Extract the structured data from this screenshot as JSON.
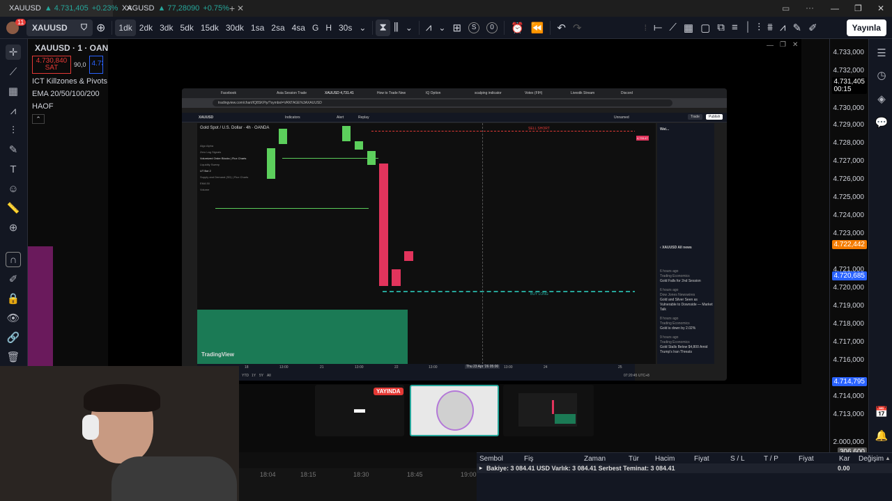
{
  "tabs": [
    {
      "symbol": "XAUUSD",
      "price": "4.731,405",
      "change": "+0.23%"
    },
    {
      "symbol": "XAGUSD",
      "price": "77,28090",
      "change": "+0.75%"
    }
  ],
  "new_tab": "+",
  "window_controls": {
    "minimize": "—",
    "maximize": "❐",
    "close": "✕"
  },
  "toolbar": {
    "notif_count": "11",
    "symbol": "XAUUSD",
    "intervals": [
      "1dk",
      "2dk",
      "3dk",
      "5dk",
      "15dk",
      "30dk",
      "1sa",
      "2sa",
      "4sa",
      "G",
      "H",
      "30s"
    ],
    "selected_interval": "1dk",
    "counter_s": "S",
    "counter_0": "0",
    "publish": "Yayınla"
  },
  "legend": {
    "title": "XAUUSD · 1 · OAND",
    "sell": "4.730,840",
    "sell_label": "SAT",
    "spread": "90,0",
    "buy": "4.73",
    "ind1": "ICT Killzones & Pivots [TF",
    "ind2": "EMA 20/50/100/200",
    "ind3": "HAOF"
  },
  "axis": {
    "labels": [
      "4.733,000",
      "4.732,000",
      "4.730,000",
      "4.729,000",
      "4.728,000",
      "4.727,000",
      "4.726,000",
      "4.725,000",
      "4.724,000",
      "4.723,000",
      "4.721,000",
      "4.720,000",
      "4.719,000",
      "4.718,000",
      "4.717,000",
      "4.716,000",
      "4.714,000",
      "4.713,000",
      "2.000,000"
    ],
    "current": "4.731,405",
    "timer": "00:15",
    "tag1": "4.722,442",
    "tag1_color": "#f57c00",
    "tag2": "4.720,685",
    "tag2_color": "#2962ff",
    "tag3": "4.714,795",
    "tag3_color": "#2962ff",
    "tag4": "306.600"
  },
  "inner": {
    "tabs": [
      "Facebook",
      "Asia Session Trade",
      "XAUUSD 4,731.41",
      "How to Trade New",
      "IQ Option",
      "scalping indicator",
      "Votex (FIH)",
      "Livestik Stream",
      "Discord"
    ],
    "url": "tradingview.com/chart/IQ8SKPiy/?symbol=VANTAGE%3AXAUUSD",
    "symbol": "XAUUSD",
    "chart_title": "Gold Spot / U.S. Dollar · 4h · OANDA",
    "sell_short": "SELL SHORT",
    "buy_long": "BUY LONG",
    "indicators": "Indicators",
    "alert": "Alert",
    "replay": "Replay",
    "trade": "Trade",
    "publish": "Publish",
    "unnamed": "Unnamed",
    "ind_lines": [
      "Algo Alpha",
      "Zero Lag Signals",
      "Volumized Order Blocks | Flux Charts",
      "Liquidity Sweep",
      "UT Bot 2",
      "Supply and Demand (SD) | Flux Charts",
      "EMA 50",
      "Volume"
    ],
    "time_labels": [
      "18",
      "13:00",
      "21",
      "13:00",
      "22",
      "13:00",
      "Thu 23 Apr '26 05:00",
      "13:00",
      "24",
      "25"
    ],
    "periods": [
      "1D",
      "5D",
      "1M",
      "3M",
      "6M",
      "YTD",
      "1Y",
      "5Y",
      "All"
    ],
    "clock": "07:20:45 UTC+8",
    "watchlist_title": "Wat...",
    "news_title": "XAUUSD All news",
    "news": [
      {
        "time": "6 hours ago",
        "src": "Trading Economics",
        "title": "Gold Falls for 2nd Session"
      },
      {
        "time": "6 hours ago",
        "src": "Dow Jones Newswires",
        "title": "Gold and Silver Seen as Vulnerable to Downside — Market Talk"
      },
      {
        "time": "8 hours ago",
        "src": "Trading Economics",
        "title": "Gold is down by 2.02%"
      },
      {
        "time": "9 hours ago",
        "src": "Trading Economics",
        "title": "Gold Stalls Below $4,800 Amid Trump's Iran Threats"
      }
    ],
    "tv_logo": "TradingView",
    "axis_prices": [
      "4,795.000",
      "4,785.000",
      "4,780.000",
      "4,775.000",
      "4,770.000",
      "4,765.000",
      "4,760.000",
      "4,755.000",
      "4,750.000",
      "4,745.000",
      "4,740.000",
      "4,735.000",
      "4,730.000",
      "4,725.000",
      "4,720.000",
      "4,715.000",
      "4,710.000",
      "4,705.000",
      "4,700.000",
      "4,695.000",
      "4,690.000",
      "4,685.000",
      "4,680.000"
    ]
  },
  "live_badge": "YAYINDA",
  "time_strip": [
    "18:04",
    "18:15",
    "18:30",
    "18:45",
    "19:00"
  ],
  "bottom": {
    "headers": [
      "Sembol",
      "Fiş",
      "Zaman",
      "Tür",
      "Hacim",
      "Fiyat",
      "S / L",
      "T / P",
      "Fiyat",
      "Kar",
      "Değişim"
    ],
    "balance": "Bakiye: 3 084.41 USD  Varlık: 3 084.41  Serbest Teminat: 3 084.41",
    "profit": "0.00"
  }
}
